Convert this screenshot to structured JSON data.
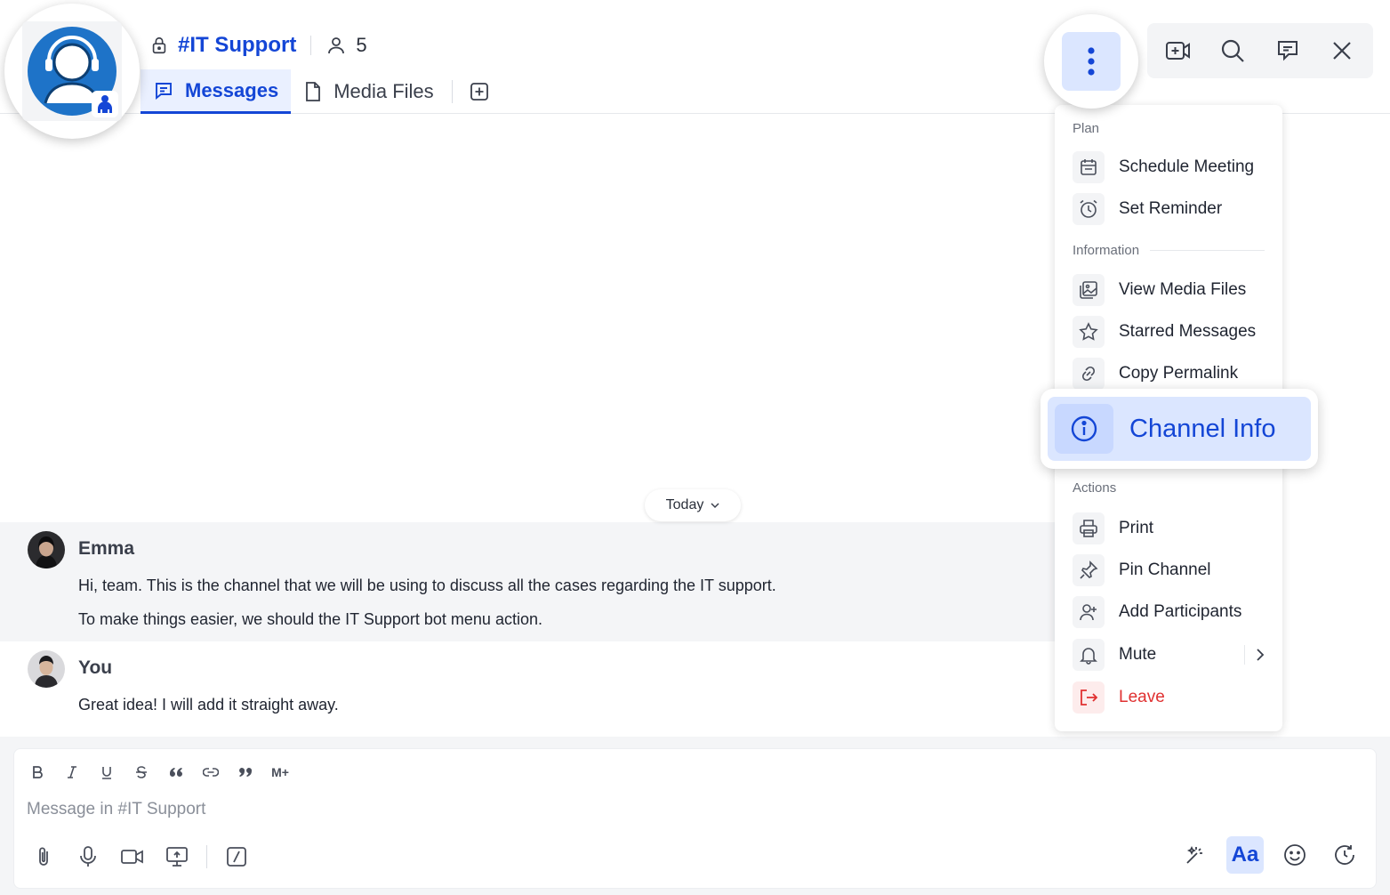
{
  "channel": {
    "name": "#IT Support",
    "member_count": "5"
  },
  "tabs": [
    {
      "label": "Messages",
      "active": true
    },
    {
      "label": "Media Files",
      "active": false
    }
  ],
  "header_tools": [
    "video-add-icon",
    "search-icon",
    "thread-icon",
    "close-icon"
  ],
  "menu": {
    "sections": {
      "plan": "Plan",
      "information": "Information",
      "actions": "Actions"
    },
    "items": {
      "schedule_meeting": "Schedule Meeting",
      "set_reminder": "Set Reminder",
      "view_media_files": "View Media Files",
      "starred_messages": "Starred Messages",
      "copy_permalink": "Copy Permalink",
      "channel_info": "Channel Info",
      "print": "Print",
      "pin_channel": "Pin Channel",
      "add_participants": "Add Participants",
      "mute": "Mute",
      "leave": "Leave"
    }
  },
  "date_divider": "Today",
  "messages": [
    {
      "author": "Emma",
      "lines": [
        "Hi, team. This is the channel that we will be using to discuss all the cases regarding the IT support.",
        "To make things easier, we should the IT Support bot menu action."
      ]
    },
    {
      "author": "You",
      "lines": [
        "Great idea! I will add it straight away."
      ]
    }
  ],
  "composer": {
    "placeholder": "Message in #IT Support",
    "format_tools": [
      "bold",
      "italic",
      "underline",
      "strikethrough",
      "quote-open",
      "link",
      "quote-close",
      "markdown"
    ],
    "markdown_label": "M+",
    "font_button_label": "Aa"
  },
  "colors": {
    "accent": "#1446d6",
    "accent_light": "#dbe6ff",
    "danger": "#e03131",
    "highlight_row": "#f4f5f7"
  }
}
